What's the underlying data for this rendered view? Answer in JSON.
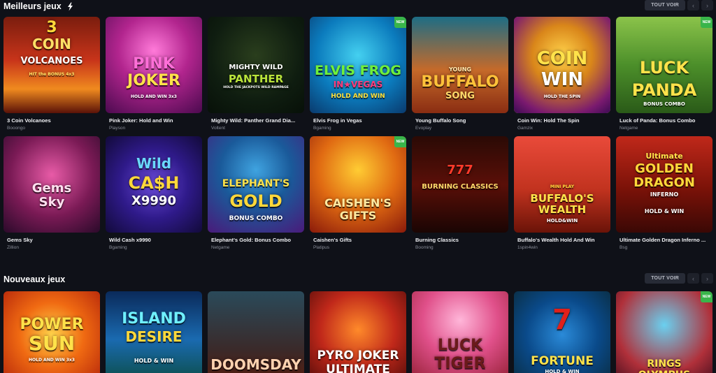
{
  "sections": [
    {
      "title": "Meilleurs jeux",
      "see_all": "TOUT VOIR",
      "games": [
        {
          "name": "3 Coin Volcanoes",
          "provider": "Booongo",
          "logo": [
            "3",
            "COIN",
            "VOLCANOES",
            "HIT the BONUS 4x3"
          ],
          "new": false
        },
        {
          "name": "Pink Joker: Hold and Win",
          "provider": "Playson",
          "logo": [
            "PINK",
            "JOKER",
            "HOLD AND WIN 3x3"
          ],
          "new": false
        },
        {
          "name": "Mighty Wild: Panther Grand Dia...",
          "provider": "Voltent",
          "logo": [
            "MIGHTY WILD",
            "PANTHER",
            "HOLD THE JACKPOTS WILD RAMPAGE"
          ],
          "new": false
        },
        {
          "name": "Elvis Frog in Vegas",
          "provider": "Bgaming",
          "logo": [
            "ELVIS FROG",
            "IN★VEGAS",
            "HOLD AND WIN"
          ],
          "new": true
        },
        {
          "name": "Young Buffalo Song",
          "provider": "Evoplay",
          "logo": [
            "YOUNG",
            "BUFFALO",
            "SONG"
          ],
          "new": false
        },
        {
          "name": "Coin Win: Hold The Spin",
          "provider": "Gamzix",
          "logo": [
            "COIN",
            "WIN",
            "HOLD THE SPIN"
          ],
          "new": false
        },
        {
          "name": "Luck of Panda: Bonus Combo",
          "provider": "Netgame",
          "logo": [
            "LUCK",
            "PANDA",
            "BONUS COMBO"
          ],
          "new": true
        },
        {
          "name": "Gems Sky",
          "provider": "Zillion",
          "logo": [
            "Gems",
            "Sky"
          ],
          "new": false
        },
        {
          "name": "Wild Cash x9990",
          "provider": "Bgaming",
          "logo": [
            "Wild",
            "CA$H",
            "X9990"
          ],
          "new": false
        },
        {
          "name": "Elephant's Gold: Bonus Combo",
          "provider": "Netgame",
          "logo": [
            "ELEPHANT'S",
            "GOLD",
            "BONUS COMBO"
          ],
          "new": false
        },
        {
          "name": "Caishen's Gifts",
          "provider": "Platipus",
          "logo": [
            "CAISHEN'S",
            "GIFTS"
          ],
          "new": true
        },
        {
          "name": "Burning Classics",
          "provider": "Booming",
          "logo": [
            "777",
            "BURNING CLASSICS"
          ],
          "new": false
        },
        {
          "name": "Buffalo's Wealth Hold And Win",
          "provider": "1spin4win",
          "logo": [
            "MINI PLAY",
            "BUFFALO'S",
            "WEALTH",
            "HOLD&WIN"
          ],
          "new": false
        },
        {
          "name": "Ultimate Golden Dragon Inferno ...",
          "provider": "Bsg",
          "logo": [
            "Ultimate",
            "GOLDEN",
            "DRAGON",
            "INFERNO",
            "HOLD & WIN"
          ],
          "new": false
        }
      ]
    },
    {
      "title": "Nouveaux jeux",
      "see_all": "TOUT VOIR",
      "games": [
        {
          "logo": [
            "POWER",
            "SUN",
            "HOLD AND WIN 3x3"
          ],
          "new": false
        },
        {
          "logo": [
            "ISLAND",
            "DESIRE",
            "HOLD & WIN"
          ],
          "new": false
        },
        {
          "logo": [
            "DOOMSDAY"
          ],
          "new": false
        },
        {
          "logo": [
            "PYRO JOKER",
            "ULTIMATE"
          ],
          "new": false
        },
        {
          "logo": [
            "LUCK",
            "TIGER"
          ],
          "new": false
        },
        {
          "logo": [
            "7",
            "FORTUNE",
            "HOLD & WIN"
          ],
          "new": false
        },
        {
          "logo": [
            "RINGS",
            "OLYMPUS"
          ],
          "new": true
        }
      ]
    }
  ],
  "badge_new": "NEW",
  "arrows": {
    "prev": "‹",
    "next": "›"
  },
  "colors": {
    "background": "#0f1118",
    "button": "#272b36",
    "new_badge": "#39b54a",
    "gold_frame": "#e3b23c"
  }
}
